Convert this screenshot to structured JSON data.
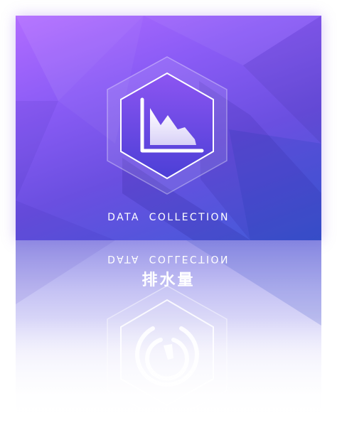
{
  "card": {
    "title": "DATA COLLECTION",
    "icon": "area-chart-icon",
    "accent_top": "#b26cff",
    "accent_bottom": "#3f5bd8"
  },
  "reflection": {
    "mirrored_title": "DATA COLLECTION",
    "subtitle": "排水量",
    "icon": "gauge-icon"
  }
}
